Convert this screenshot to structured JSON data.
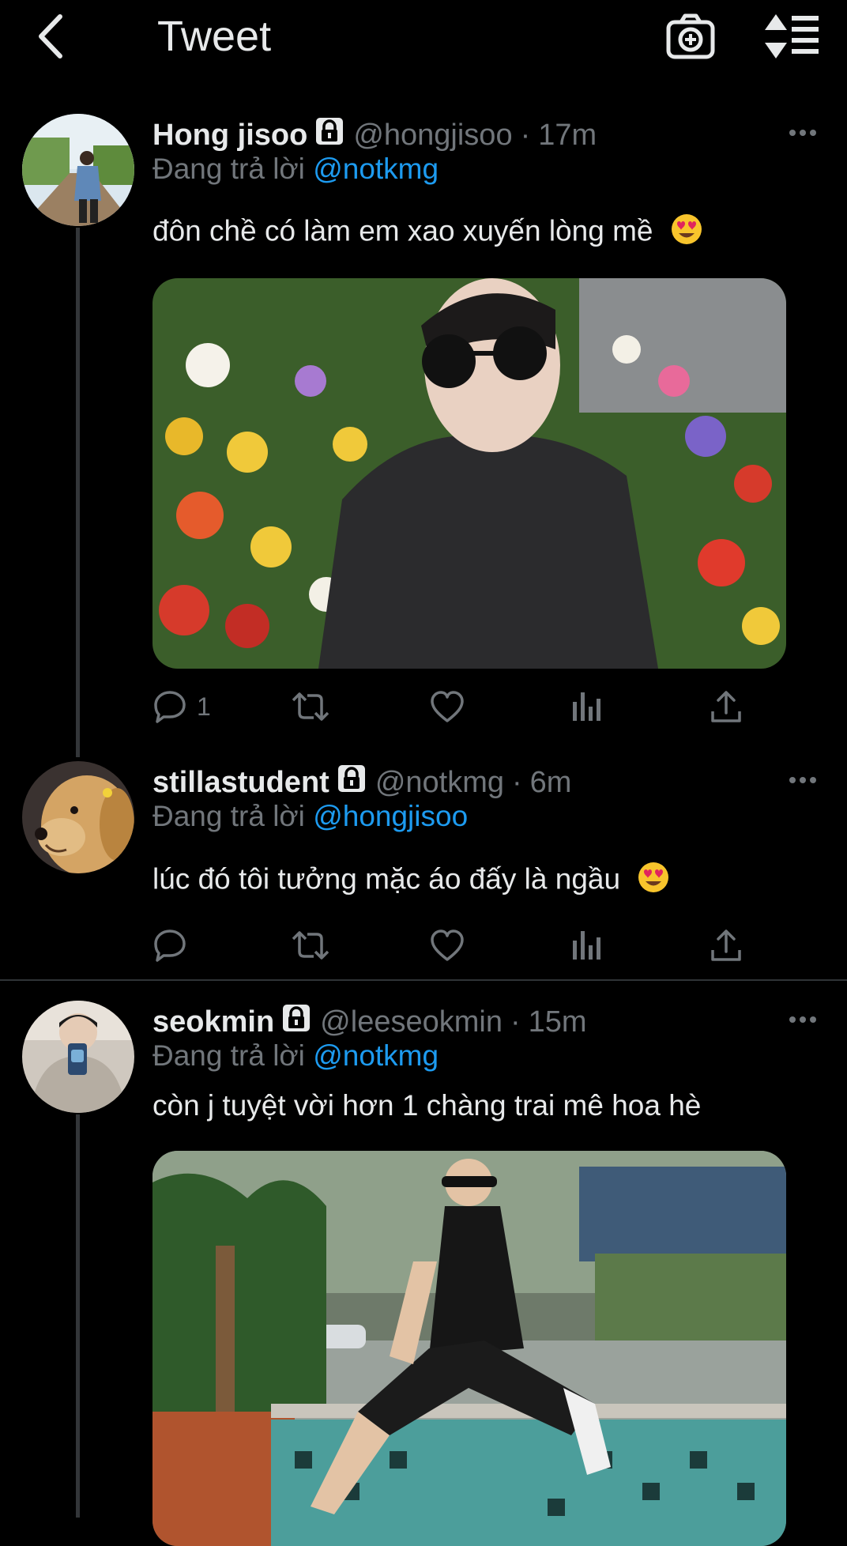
{
  "header": {
    "title": "Tweet",
    "back_icon": "chevron-left-icon",
    "camera_icon": "camera-plus-icon",
    "sort_icon": "sort-lines-icon"
  },
  "colors": {
    "accent": "#1d9bf0",
    "muted": "#71767b",
    "background": "#000000",
    "text": "#e7e9ea"
  },
  "tweets": [
    {
      "display_name": "Hong jisoo",
      "handle": "@hongjisoo",
      "separator": "·",
      "time": "17m",
      "reply_prefix": "Đang trả lời",
      "reply_to": "@notkmg",
      "text": "đôn chề có làm em xao xuyến lòng mề",
      "emoji": "smiling-face-with-heart-eyes",
      "reply_count": "1",
      "has_media": true
    },
    {
      "display_name": "stillastudent",
      "handle": "@notkmg",
      "separator": "·",
      "time": "6m",
      "reply_prefix": "Đang trả lời",
      "reply_to": "@hongjisoo",
      "text": "lúc đó tôi tưởng mặc áo đấy là ngầu",
      "emoji": "smiling-face-with-heart-eyes",
      "reply_count": "",
      "has_media": false
    },
    {
      "display_name": "seokmin",
      "handle": "@leeseokmin",
      "separator": "·",
      "time": "15m",
      "reply_prefix": "Đang trả lời",
      "reply_to": "@notkmg",
      "text": "còn j tuyệt vời hơn 1 chàng trai mê hoa hè",
      "emoji": "",
      "reply_count": "",
      "has_media": true
    }
  ]
}
